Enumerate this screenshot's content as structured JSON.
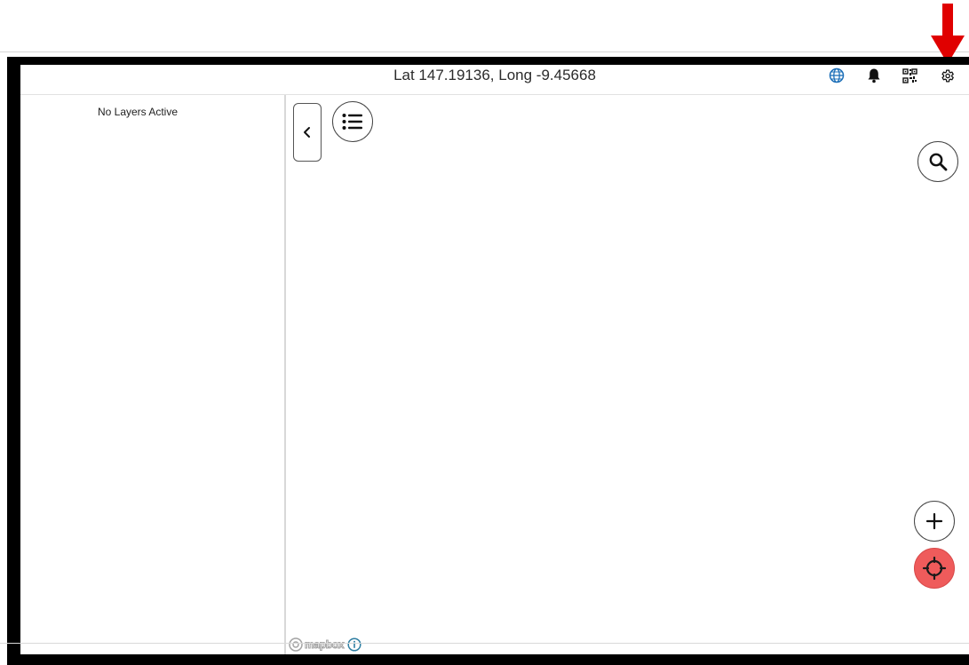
{
  "header": {
    "coordinates": "Lat 147.19136, Long -9.45668"
  },
  "toolbar": {
    "icons": [
      "globe-icon",
      "bell-icon",
      "qr-code-icon",
      "gear-icon"
    ]
  },
  "sidebar": {
    "empty_text": "No Layers Active"
  },
  "map": {
    "attribution": "mapbox"
  },
  "colors": {
    "globe": "#1d6fb8",
    "locate_button": "#ef5b5b",
    "annotation_arrow": "#e00000",
    "frame": "#000000"
  }
}
